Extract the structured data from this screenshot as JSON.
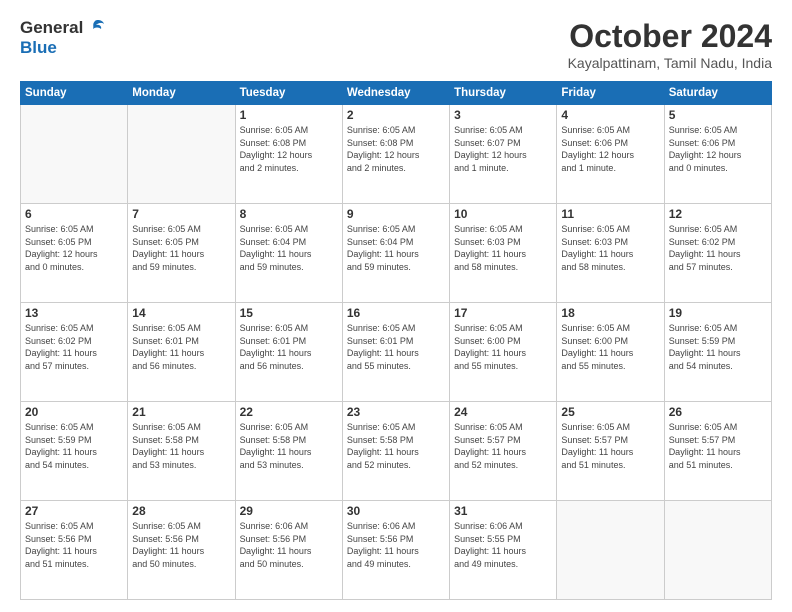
{
  "logo": {
    "general": "General",
    "blue": "Blue"
  },
  "title": "October 2024",
  "location": "Kayalpattinam, Tamil Nadu, India",
  "headers": [
    "Sunday",
    "Monday",
    "Tuesday",
    "Wednesday",
    "Thursday",
    "Friday",
    "Saturday"
  ],
  "weeks": [
    [
      {
        "day": "",
        "info": ""
      },
      {
        "day": "",
        "info": ""
      },
      {
        "day": "1",
        "info": "Sunrise: 6:05 AM\nSunset: 6:08 PM\nDaylight: 12 hours\nand 2 minutes."
      },
      {
        "day": "2",
        "info": "Sunrise: 6:05 AM\nSunset: 6:08 PM\nDaylight: 12 hours\nand 2 minutes."
      },
      {
        "day": "3",
        "info": "Sunrise: 6:05 AM\nSunset: 6:07 PM\nDaylight: 12 hours\nand 1 minute."
      },
      {
        "day": "4",
        "info": "Sunrise: 6:05 AM\nSunset: 6:06 PM\nDaylight: 12 hours\nand 1 minute."
      },
      {
        "day": "5",
        "info": "Sunrise: 6:05 AM\nSunset: 6:06 PM\nDaylight: 12 hours\nand 0 minutes."
      }
    ],
    [
      {
        "day": "6",
        "info": "Sunrise: 6:05 AM\nSunset: 6:05 PM\nDaylight: 12 hours\nand 0 minutes."
      },
      {
        "day": "7",
        "info": "Sunrise: 6:05 AM\nSunset: 6:05 PM\nDaylight: 11 hours\nand 59 minutes."
      },
      {
        "day": "8",
        "info": "Sunrise: 6:05 AM\nSunset: 6:04 PM\nDaylight: 11 hours\nand 59 minutes."
      },
      {
        "day": "9",
        "info": "Sunrise: 6:05 AM\nSunset: 6:04 PM\nDaylight: 11 hours\nand 59 minutes."
      },
      {
        "day": "10",
        "info": "Sunrise: 6:05 AM\nSunset: 6:03 PM\nDaylight: 11 hours\nand 58 minutes."
      },
      {
        "day": "11",
        "info": "Sunrise: 6:05 AM\nSunset: 6:03 PM\nDaylight: 11 hours\nand 58 minutes."
      },
      {
        "day": "12",
        "info": "Sunrise: 6:05 AM\nSunset: 6:02 PM\nDaylight: 11 hours\nand 57 minutes."
      }
    ],
    [
      {
        "day": "13",
        "info": "Sunrise: 6:05 AM\nSunset: 6:02 PM\nDaylight: 11 hours\nand 57 minutes."
      },
      {
        "day": "14",
        "info": "Sunrise: 6:05 AM\nSunset: 6:01 PM\nDaylight: 11 hours\nand 56 minutes."
      },
      {
        "day": "15",
        "info": "Sunrise: 6:05 AM\nSunset: 6:01 PM\nDaylight: 11 hours\nand 56 minutes."
      },
      {
        "day": "16",
        "info": "Sunrise: 6:05 AM\nSunset: 6:01 PM\nDaylight: 11 hours\nand 55 minutes."
      },
      {
        "day": "17",
        "info": "Sunrise: 6:05 AM\nSunset: 6:00 PM\nDaylight: 11 hours\nand 55 minutes."
      },
      {
        "day": "18",
        "info": "Sunrise: 6:05 AM\nSunset: 6:00 PM\nDaylight: 11 hours\nand 55 minutes."
      },
      {
        "day": "19",
        "info": "Sunrise: 6:05 AM\nSunset: 5:59 PM\nDaylight: 11 hours\nand 54 minutes."
      }
    ],
    [
      {
        "day": "20",
        "info": "Sunrise: 6:05 AM\nSunset: 5:59 PM\nDaylight: 11 hours\nand 54 minutes."
      },
      {
        "day": "21",
        "info": "Sunrise: 6:05 AM\nSunset: 5:58 PM\nDaylight: 11 hours\nand 53 minutes."
      },
      {
        "day": "22",
        "info": "Sunrise: 6:05 AM\nSunset: 5:58 PM\nDaylight: 11 hours\nand 53 minutes."
      },
      {
        "day": "23",
        "info": "Sunrise: 6:05 AM\nSunset: 5:58 PM\nDaylight: 11 hours\nand 52 minutes."
      },
      {
        "day": "24",
        "info": "Sunrise: 6:05 AM\nSunset: 5:57 PM\nDaylight: 11 hours\nand 52 minutes."
      },
      {
        "day": "25",
        "info": "Sunrise: 6:05 AM\nSunset: 5:57 PM\nDaylight: 11 hours\nand 51 minutes."
      },
      {
        "day": "26",
        "info": "Sunrise: 6:05 AM\nSunset: 5:57 PM\nDaylight: 11 hours\nand 51 minutes."
      }
    ],
    [
      {
        "day": "27",
        "info": "Sunrise: 6:05 AM\nSunset: 5:56 PM\nDaylight: 11 hours\nand 51 minutes."
      },
      {
        "day": "28",
        "info": "Sunrise: 6:05 AM\nSunset: 5:56 PM\nDaylight: 11 hours\nand 50 minutes."
      },
      {
        "day": "29",
        "info": "Sunrise: 6:06 AM\nSunset: 5:56 PM\nDaylight: 11 hours\nand 50 minutes."
      },
      {
        "day": "30",
        "info": "Sunrise: 6:06 AM\nSunset: 5:56 PM\nDaylight: 11 hours\nand 49 minutes."
      },
      {
        "day": "31",
        "info": "Sunrise: 6:06 AM\nSunset: 5:55 PM\nDaylight: 11 hours\nand 49 minutes."
      },
      {
        "day": "",
        "info": ""
      },
      {
        "day": "",
        "info": ""
      }
    ]
  ]
}
